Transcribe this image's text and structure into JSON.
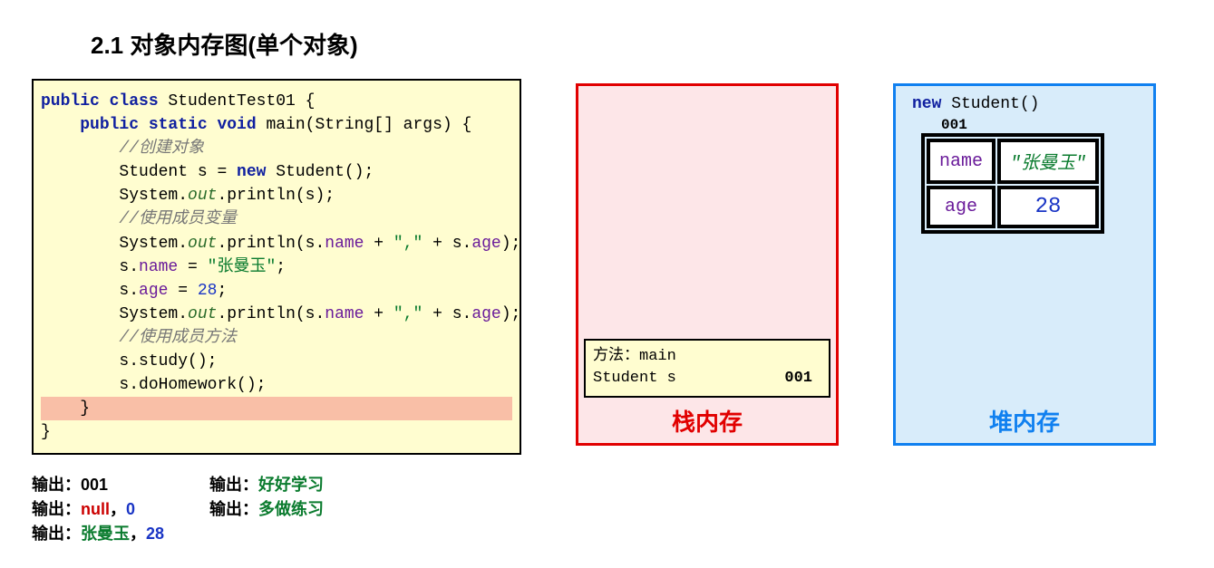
{
  "title": "2.1 对象内存图(单个对象)",
  "code": {
    "decl1": "public class",
    "cls": " StudentTest01 {",
    "decl2": "public static void",
    "main": " main(String[] args) {",
    "c1": "//创建对象",
    "l3a": "Student s = ",
    "l3b": "new",
    "l3c": " Student();",
    "l4a": "System.",
    "l4b": "out",
    "l4c": ".println(s);",
    "c2": "//使用成员变量",
    "l6a": "System.",
    "l6b": "out",
    "l6c": ".println(s.",
    "l6d": "name",
    "l6e": " + ",
    "l6f": "\",\"",
    "l6g": " + s.",
    "l6h": "age",
    "l6i": ");",
    "l7a": "s.",
    "l7b": "name",
    "l7c": " = ",
    "l7d": "\"张曼玉\"",
    "l7e": ";",
    "l8a": "s.",
    "l8b": "age",
    "l8c": " = ",
    "l8d": "28",
    "l8e": ";",
    "l9a": "System.",
    "l9b": "out",
    "l9c": ".println(s.",
    "l9d": "name",
    "l9e": " + ",
    "l9f": "\",\"",
    "l9g": " + s.",
    "l9h": "age",
    "l9i": ");",
    "c3": "//使用成员方法",
    "l11": "s.study();",
    "l12": "s.doHomework();",
    "rb1": "}",
    "rb2": "}"
  },
  "stack": {
    "label": "栈内存",
    "frame_l1a": "方法：",
    "frame_l1b": "main",
    "frame_l2a": "Student s",
    "frame_l2b": "001"
  },
  "heap": {
    "label": "堆内存",
    "new_kw": "new",
    "new_rest": " Student()",
    "addr": "001",
    "k1": "name",
    "v1": "\"张曼玉\"",
    "k2": "age",
    "v2": "28"
  },
  "output": {
    "pfx": "输出：",
    "o1": "001",
    "o2_a": "null",
    "o2_b": "，",
    "o2_c": "0",
    "o3_a": "张曼玉",
    "o3_b": "，",
    "o3_c": "28",
    "o4": "好好学习",
    "o5": "多做练习"
  },
  "chart_data": {
    "type": "diagram",
    "title": "Java single-object memory diagram",
    "stack": {
      "frame": "main",
      "vars": [
        {
          "name": "Student s",
          "ref": "001"
        }
      ]
    },
    "heap": {
      "001": {
        "class": "Student",
        "fields": {
          "name": "张曼玉",
          "age": 28
        }
      }
    },
    "console_output": [
      "001",
      "null，0",
      "张曼玉，28",
      "好好学习",
      "多做练习"
    ]
  }
}
